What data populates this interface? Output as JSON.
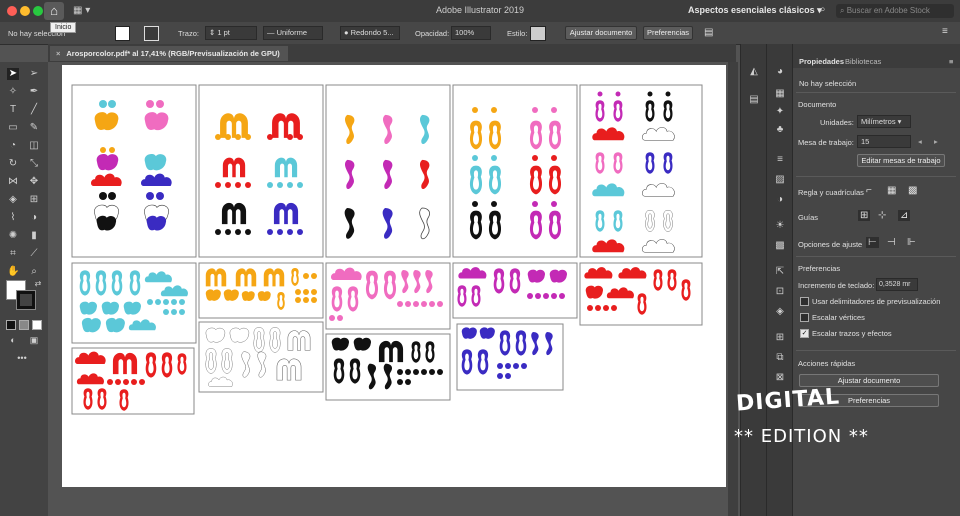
{
  "window": {
    "title": "Adobe Illustrator 2019",
    "workspace": "Aspectos esenciales clásicos",
    "search_placeholder": "Buscar en Adobe Stock",
    "home_tooltip": "Inicio"
  },
  "control_bar": {
    "selection": "No hay selección",
    "stroke_label": "Trazo:",
    "stroke_value": "1 pt",
    "stroke_profile": "Uniforme",
    "brush": "Redondo 5...",
    "opacity_label": "Opacidad:",
    "opacity_value": "100%",
    "style_label": "Estilo:",
    "fit_button": "Ajustar documento",
    "prefs_button": "Preferencias"
  },
  "document_tab": {
    "label": "Arosporcolor.pdf* al 17,41% (RGB/Previsualización de GPU)"
  },
  "properties_panel": {
    "tabs": [
      "Propiedades",
      "Bibliotecas"
    ],
    "no_selection": "No hay selección",
    "document_heading": "Documento",
    "units_label": "Unidades:",
    "units_value": "Milímetros",
    "artboard_label": "Mesa de trabajo:",
    "artboard_value": "15",
    "edit_artboards_button": "Editar mesas de trabajo",
    "rulers_label": "Regla y cuadrículas",
    "guides_label": "Guías",
    "align_label": "Opciones de ajuste",
    "preferences_heading": "Preferencias",
    "keyboard_inc_label": "Incremento de teclado:",
    "keyboard_inc_value": "0,3528 mr",
    "use_preview_bounds": "Usar delimitadores de previsualización",
    "scale_corners": "Escalar vértices",
    "scale_strokes": "Escalar trazos y efectos",
    "quick_actions": "Acciones rápidas",
    "fit_document_button": "Ajustar documento",
    "preferences_button": "Preferencias"
  },
  "watermark": {
    "line1": "DIGITAL",
    "line2": "** EDITION **"
  },
  "colors": {
    "blue": "#5bc8d8",
    "pink": "#f06cc0",
    "orange": "#f5a614",
    "red": "#e81e1e",
    "magenta": "#c32ab5",
    "indigo": "#3a2bc2",
    "black": "#111111"
  }
}
